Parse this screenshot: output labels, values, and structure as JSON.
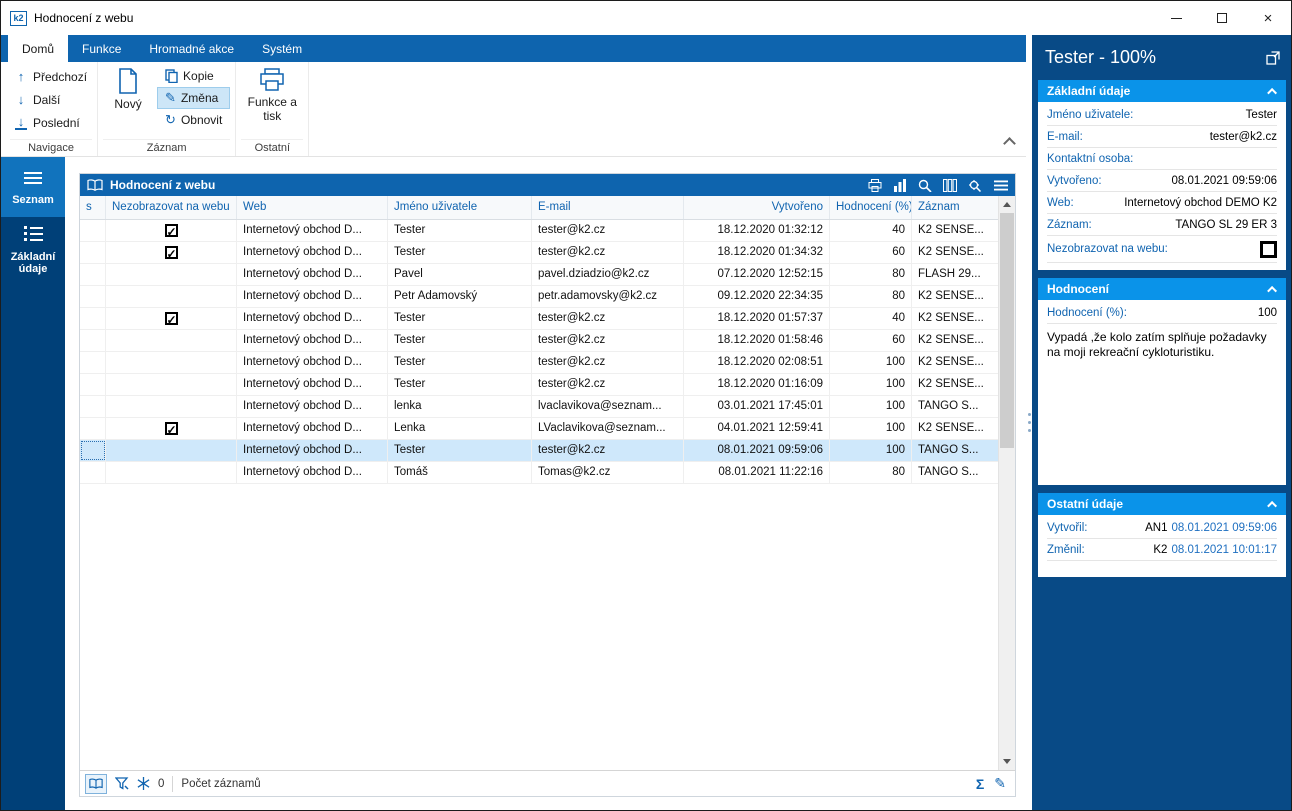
{
  "titlebar": {
    "title": "Hodnocení z webu",
    "app_icon": "k2"
  },
  "tabs": {
    "items": [
      {
        "label": "Domů",
        "active": true
      },
      {
        "label": "Funkce",
        "active": false
      },
      {
        "label": "Hromadné akce",
        "active": false
      },
      {
        "label": "Systém",
        "active": false
      }
    ]
  },
  "ribbon": {
    "nav": {
      "prev": "Předchozí",
      "next": "Další",
      "last": "Poslední",
      "group": "Navigace"
    },
    "record": {
      "new": "Nový",
      "copy": "Kopie",
      "change": "Změna",
      "refresh": "Obnovit",
      "group": "Záznam"
    },
    "other": {
      "func_print": "Funkce a tisk",
      "group": "Ostatní"
    }
  },
  "sidebar": {
    "items": [
      {
        "label": "Seznam",
        "active": true
      },
      {
        "label": "Základní údaje",
        "active": false
      }
    ]
  },
  "table": {
    "title": "Hodnocení z webu",
    "columns": [
      "s",
      "Nezobrazovat na webu",
      "Web",
      "Jméno uživatele",
      "E-mail",
      "Vytvořeno",
      "Hodnocení (%)",
      "Záznam"
    ],
    "rows": [
      {
        "checked": true,
        "web": "Internetový obchod D...",
        "user": "Tester",
        "email": "tester@k2.cz",
        "created": "18.12.2020 01:32:12",
        "rating": "40",
        "record": "K2 SENSE..."
      },
      {
        "checked": true,
        "web": "Internetový obchod D...",
        "user": "Tester",
        "email": "tester@k2.cz",
        "created": "18.12.2020 01:34:32",
        "rating": "60",
        "record": "K2 SENSE..."
      },
      {
        "checked": false,
        "web": "Internetový obchod D...",
        "user": "Pavel",
        "email": "pavel.dziadzio@k2.cz",
        "created": "07.12.2020 12:52:15",
        "rating": "80",
        "record": "FLASH 29..."
      },
      {
        "checked": false,
        "web": "Internetový obchod D...",
        "user": "Petr Adamovský",
        "email": "petr.adamovsky@k2.cz",
        "created": "09.12.2020 22:34:35",
        "rating": "80",
        "record": "K2 SENSE..."
      },
      {
        "checked": true,
        "web": "Internetový obchod D...",
        "user": "Tester",
        "email": "tester@k2.cz",
        "created": "18.12.2020 01:57:37",
        "rating": "40",
        "record": "K2 SENSE..."
      },
      {
        "checked": false,
        "web": "Internetový obchod D...",
        "user": "Tester",
        "email": "tester@k2.cz",
        "created": "18.12.2020 01:58:46",
        "rating": "60",
        "record": "K2 SENSE..."
      },
      {
        "checked": false,
        "web": "Internetový obchod D...",
        "user": "Tester",
        "email": "tester@k2.cz",
        "created": "18.12.2020 02:08:51",
        "rating": "100",
        "record": "K2 SENSE..."
      },
      {
        "checked": false,
        "web": "Internetový obchod D...",
        "user": "Tester",
        "email": "tester@k2.cz",
        "created": "18.12.2020 01:16:09",
        "rating": "100",
        "record": "K2 SENSE..."
      },
      {
        "checked": false,
        "web": "Internetový obchod D...",
        "user": "lenka",
        "email": "lvaclavikova@seznam...",
        "created": "03.01.2021 17:45:01",
        "rating": "100",
        "record": "TANGO S..."
      },
      {
        "checked": true,
        "web": "Internetový obchod D...",
        "user": "Lenka",
        "email": "LVaclavikova@seznam...",
        "created": "04.01.2021 12:59:41",
        "rating": "100",
        "record": "K2 SENSE..."
      },
      {
        "checked": false,
        "selected": true,
        "focus": true,
        "web": "Internetový obchod D...",
        "user": "Tester",
        "email": "tester@k2.cz",
        "created": "08.01.2021 09:59:06",
        "rating": "100",
        "record": "TANGO S..."
      },
      {
        "checked": false,
        "web": "Internetový obchod D...",
        "user": "Tomáš",
        "email": "Tomas@k2.cz",
        "created": "08.01.2021 11:22:16",
        "rating": "80",
        "record": "TANGO S..."
      }
    ]
  },
  "statusbar": {
    "count": "0",
    "records_label": "Počet záznamů"
  },
  "panel": {
    "title": "Tester - 100%",
    "basic": {
      "header": "Základní údaje",
      "fields": [
        {
          "label": "Jméno uživatele:",
          "value": "Tester"
        },
        {
          "label": "E-mail:",
          "value": "tester@k2.cz"
        },
        {
          "label": "Kontaktní osoba:",
          "value": ""
        },
        {
          "label": "Vytvořeno:",
          "value": "08.01.2021 09:59:06"
        },
        {
          "label": "Web:",
          "value": "Internetový obchod DEMO K2"
        },
        {
          "label": "Záznam:",
          "value": "TANGO SL 29 ER 3"
        },
        {
          "label": "Nezobrazovat na webu:",
          "value": "",
          "checkbox": true
        }
      ]
    },
    "rating": {
      "header": "Hodnocení",
      "label": "Hodnocení (%):",
      "value": "100",
      "comment": "Vypadá ,že kolo zatím splňuje požadavky na moji rekreační cykloturistiku."
    },
    "other": {
      "header": "Ostatní údaje",
      "fields": [
        {
          "label": "Vytvořil:",
          "user": "AN1",
          "date": "08.01.2021 09:59:06"
        },
        {
          "label": "Změnil:",
          "user": "K2",
          "date": "08.01.2021 10:01:17"
        }
      ]
    }
  },
  "icons": {
    "titlebar": [
      "minimize-icon",
      "maximize-icon",
      "close-icon"
    ],
    "grid_toolbar": [
      "print-icon",
      "chart-icon",
      "search-icon",
      "columns-icon",
      "settings-search-icon",
      "menu-icon"
    ],
    "statusbar": [
      "book-icon",
      "filter-edit-icon",
      "snowflake-icon",
      "sum-icon",
      "edit-icon"
    ]
  },
  "colors": {
    "primary": "#0e64ae",
    "panel_bg": "#084a86",
    "section_header": "#0a93e9",
    "sidebar_bg": "#004078",
    "sidebar_active": "#1173bd",
    "selected_row": "#cfe8fb",
    "label_blue": "#1064b0"
  }
}
